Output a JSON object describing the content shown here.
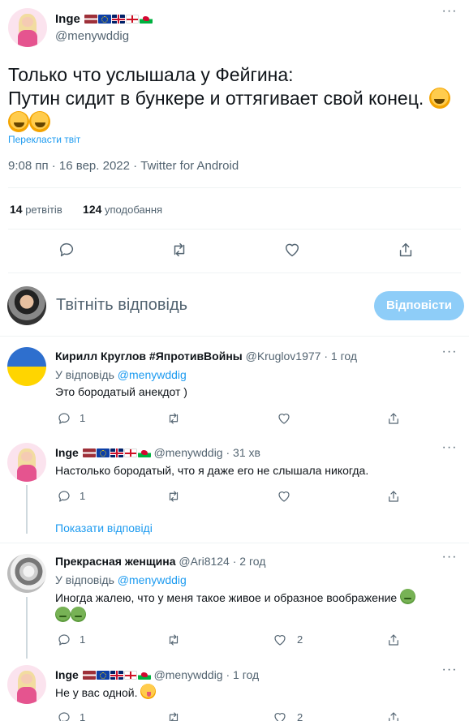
{
  "main_tweet": {
    "author_name": "Inge",
    "author_handle": "@menywddig",
    "text_line1": "Только что услышала у Фейгина:",
    "text_line2": "Путин сидит в бункере и оттягивает свой конец.",
    "translate_label": "Перекласти твіт",
    "timestamp": "9:08 пп · 16 вер. 2022 · Twitter for Android",
    "retweets_count": "14",
    "retweets_label": "ретвітів",
    "likes_count": "124",
    "likes_label": "уподобання"
  },
  "composer": {
    "placeholder": "Твітніть відповідь",
    "reply_button": "Відповісти"
  },
  "replies": [
    {
      "name": "Кирилл Круглов #ЯпротивВойны",
      "handle": "@Kruglov1977",
      "time": "· 1 год",
      "reply_to_prefix": "У відповідь",
      "reply_to_handle": "@menywddig",
      "text": "Это бородатый анекдот )",
      "reply_count": "1",
      "like_count": ""
    },
    {
      "name": "Inge",
      "handle": "@menywddig",
      "time": "· 31 хв",
      "text": "Настолько бородатый, что я даже его не слышала никогда.",
      "reply_count": "1",
      "like_count": ""
    },
    {
      "name": "Прекрасная женщина",
      "handle": "@Ari8124",
      "time": "· 2 год",
      "reply_to_prefix": "У відповідь",
      "reply_to_handle": "@menywddig",
      "text": "Иногда жалею, что у меня такое живое и образное воображение",
      "reply_count": "1",
      "like_count": "2"
    },
    {
      "name": "Inge",
      "handle": "@menywddig",
      "time": "· 1 год",
      "text": "Не у вас одной.",
      "reply_count": "1",
      "like_count": "2"
    }
  ],
  "show_replies_label": "Показати відповіді",
  "icons": {
    "reply": "reply-icon",
    "retweet": "retweet-icon",
    "like": "heart-icon",
    "share": "share-icon",
    "more": "more-icon"
  },
  "colors": {
    "accent": "#1d9bf0",
    "muted": "#536471",
    "reply_button_disabled": "#8ecdf8"
  }
}
